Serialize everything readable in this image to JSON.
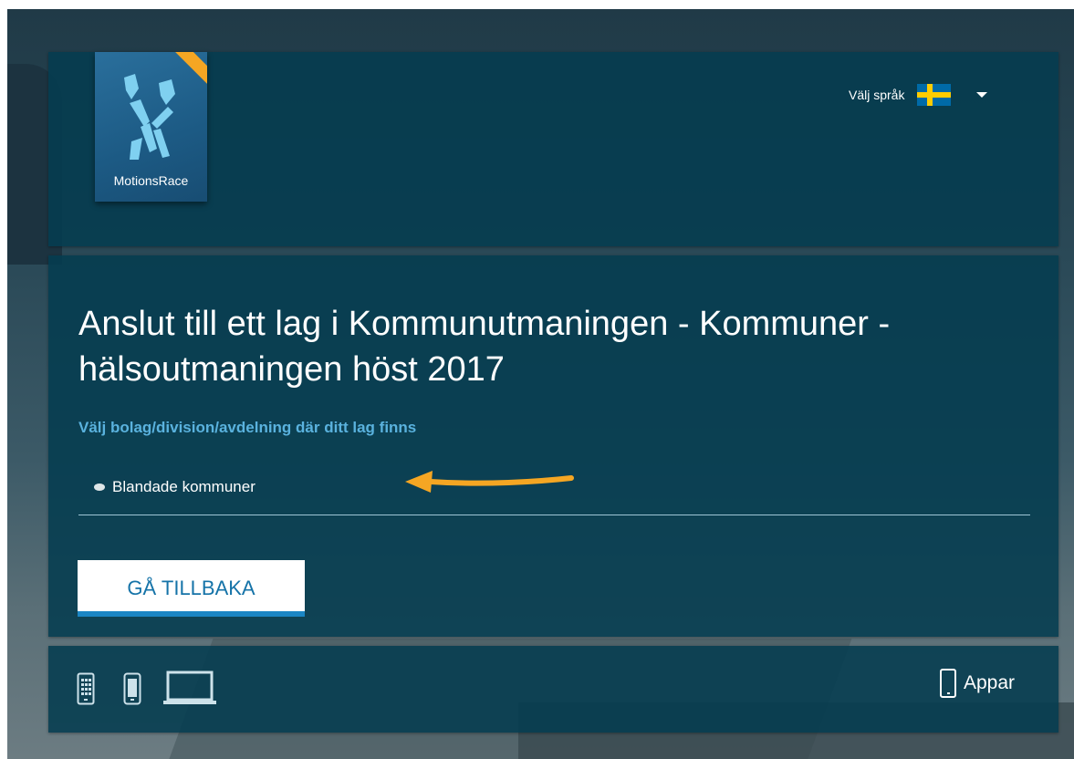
{
  "header": {
    "logo_text": "MotionsRace",
    "language_label": "Välj språk",
    "language_flag_icon": "swedish-flag-icon",
    "dropdown_icon": "caret-down-icon"
  },
  "main": {
    "title": "Anslut till ett lag i Kommunutmaningen - Kommuner - hälsoutmaningen höst 2017",
    "subtitle": "Välj bolag/division/avdelning där ditt lag finns",
    "options": [
      {
        "label": "Blandade kommuner",
        "icon": "group-icon"
      }
    ],
    "back_button": "GÅ TILLBAKA"
  },
  "footer": {
    "device_icons": [
      "tablet-icon",
      "mobile-phone-icon",
      "laptop-icon"
    ],
    "apps_label": "Appar",
    "apps_icon": "smartphone-icon"
  },
  "colors": {
    "panel": "#05495e",
    "accent_text": "#5ab2de",
    "button_text": "#1573a8",
    "button_border": "#1b86c4",
    "arrow": "#f5a623"
  }
}
